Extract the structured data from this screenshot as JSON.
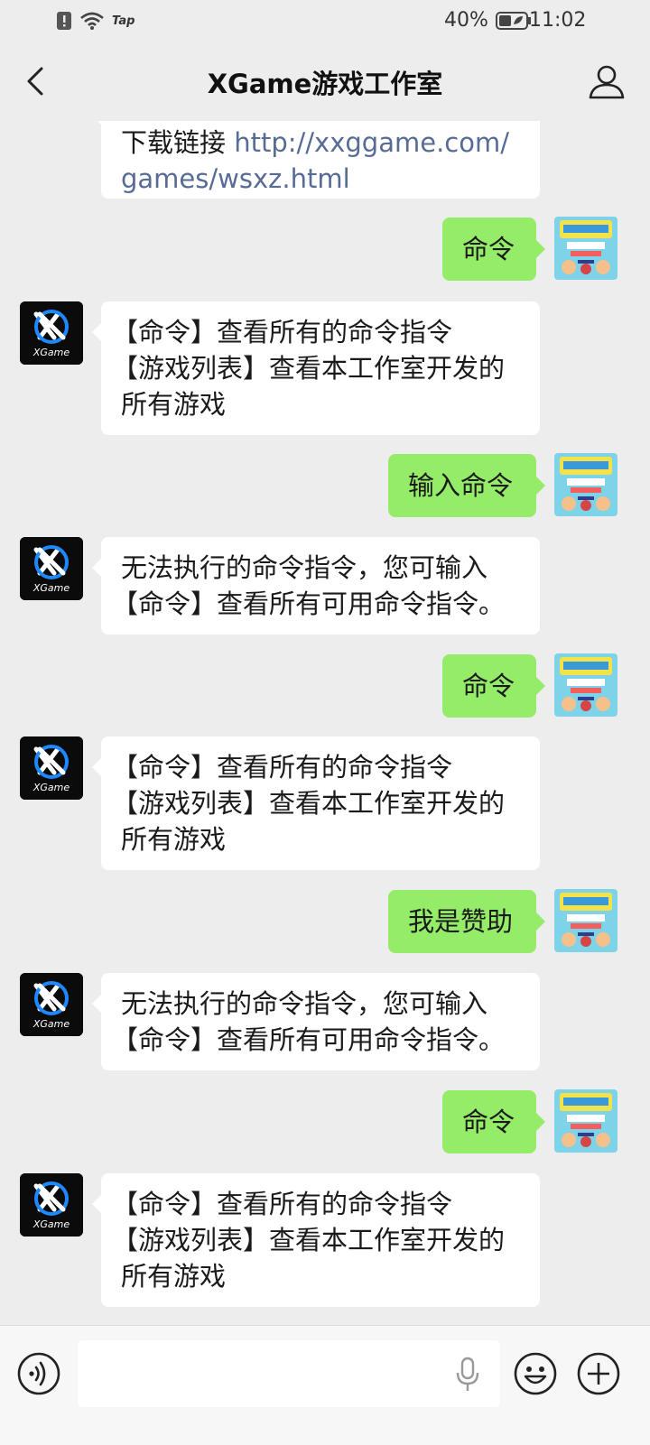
{
  "status_bar": {
    "carrier_tag": "Tap",
    "battery_percent": "40%",
    "time": "11:02"
  },
  "header": {
    "title": "XGame游戏工作室",
    "back_icon": "chevron-left-icon",
    "profile_icon": "person-icon"
  },
  "bot": {
    "avatar_label": "XGame"
  },
  "messages": [
    {
      "from": "bot",
      "lines": [
        "下载链接 ",
        "games/wsxz.html"
      ],
      "link_part": "http://xxggame.com/",
      "link_cont": "games/wsxz.html"
    },
    {
      "from": "user",
      "text": "命令"
    },
    {
      "from": "bot",
      "lines": [
        "【命令】查看所有的命令指令",
        "【游戏列表】查看本工作室开发的",
        "所有游戏"
      ]
    },
    {
      "from": "user",
      "text": "输入命令"
    },
    {
      "from": "bot",
      "lines": [
        "无法执行的命令指令，您可输入",
        "【命令】查看所有可用命令指令。"
      ]
    },
    {
      "from": "user",
      "text": "命令"
    },
    {
      "from": "bot",
      "lines": [
        "【命令】查看所有的命令指令",
        "【游戏列表】查看本工作室开发的",
        "所有游戏"
      ]
    },
    {
      "from": "user",
      "text": "我是赞助"
    },
    {
      "from": "bot",
      "lines": [
        "无法执行的命令指令，您可输入",
        "【命令】查看所有可用命令指令。"
      ]
    },
    {
      "from": "user",
      "text": "命令"
    },
    {
      "from": "bot",
      "lines": [
        "【命令】查看所有的命令指令",
        "【游戏列表】查看本工作室开发的",
        "所有游戏"
      ]
    }
  ],
  "input_bar": {
    "voice_icon": "voice-icon",
    "mic_icon": "microphone-icon",
    "emoji_icon": "emoji-icon",
    "plus_icon": "plus-icon",
    "text_value": ""
  }
}
